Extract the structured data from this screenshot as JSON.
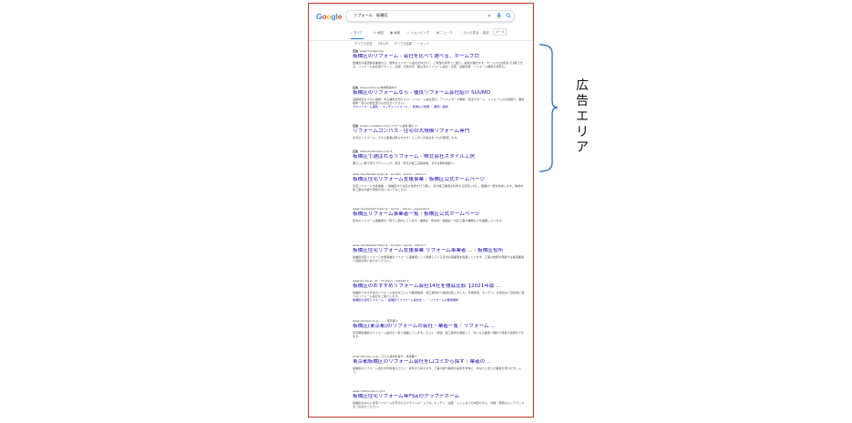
{
  "google": {
    "logo_letters": [
      {
        "ch": "G",
        "color": "#4285f4"
      },
      {
        "ch": "o",
        "color": "#ea4335"
      },
      {
        "ch": "o",
        "color": "#fbbc05"
      },
      {
        "ch": "g",
        "color": "#4285f4"
      },
      {
        "ch": "l",
        "color": "#34a853"
      },
      {
        "ch": "e",
        "color": "#ea4335"
      }
    ],
    "search_query": "リフォーム　板橋区",
    "tabs": [
      {
        "label": "すべて",
        "active": true
      },
      {
        "label": "地図",
        "active": false
      },
      {
        "label": "画像",
        "active": false
      },
      {
        "label": "ショッピング",
        "active": false
      },
      {
        "label": "ニュース",
        "active": false
      },
      {
        "label": "もっと見る",
        "active": false
      }
    ],
    "settings_label": "設定",
    "tools_label": "ツール",
    "filters": [
      "すべての言語",
      "1年以内",
      "すべての結果",
      "リセット"
    ]
  },
  "results": [
    {
      "ad": true,
      "ad_label": "広告",
      "url": "www.homepro.jp/",
      "title": "板橋区のリフォーム - 会社を比べて選べる、ホームプロ",
      "snippet": "板橋区の厳選優良業者から、優秀なリフォーム会社を5社まで、ご希望の条件でご紹介、提案が届きます。ホームプロは匿名で比較できる、リフォーム会社紹介サイト。全国・大阪方式・独立系のリフォーム会社・比較・実績多数・リフォーム費用の目安も。",
      "links": ""
    },
    {
      "ad": true,
      "ad_label": "広告",
      "url": "www.suumo.jp/地域別案内 ▾",
      "title": "板橋区のリフォームなら - 優良リフォーム会社紹介 SUUMO",
      "snippet": "実績豊富なプロに相談！安心費用を知りたい！リフォーム会社選び、アドバイザーが無料・完全サポート。リフォームのお見積り、費用相場・安心の会社選びはお任せください。",
      "links": "ブルリフォーム事例 ・ キッチンリフォーム ・ 見積もり依頼 ・ 費用・相場"
    },
    {
      "ad": true,
      "ad_label": "広告",
      "url": "www.r-compass.com/リフォーム会社/紹介 ▾",
      "title": "リフォームコンパス - 住宅の大規模リフォーム専門",
      "snippet": "大切なリフォーム、できる業者は限られます！ピッタリの会社をプロが厳選します。",
      "links": ""
    },
    {
      "ad": true,
      "ad_label": "広告",
      "url": "www.stylehouse.com/ ▾",
      "title": "板橋区で選ばれるリフォーム - 株式会社スタイル工房",
      "snippet": "暮らしに寄り添うプランニング。東京・埼玉の施工実績多数。まずは無料相談へ。",
      "links": ""
    },
    {
      "ad": false,
      "ad_label": "",
      "url": "www.city.itabashi.tokyo.jp › kurashi › sumai › reform ▾",
      "title": "板橋区住宅リフォーム支援事業｜板橋区公式ホームページ",
      "snippet": "住宅リフォーム支援事業 … 板橋区内で住宅の改修を行う際に、区内施工業者を利用する区民に対し、経費の一部を助成します。助成対象工事の内容や申請方法についてはこちら。",
      "links": ""
    },
    {
      "ad": false,
      "ad_label": "",
      "url": "www.city.itabashi.tokyo.jp › sumai › reform › jigyousha ▾",
      "title": "板橋区リフォーム事業者一覧｜板橋区公式ホームページ",
      "snippet": "区内のリフォーム事業者を一覧でご案内しています。業者名・所在地・連絡先・対応工事の種類などを掲載しています。",
      "links": ""
    },
    {
      "ad": false,
      "ad_label": "",
      "url": "www.city.itabashi.tokyo.jp › kurashi › sumai › reform ▾",
      "title": "板橋区住宅リフォーム支援事業 リフォーム事業者 ... - 板橋区役所",
      "snippet": "板橋区住宅リフォーム支援事業のリフォーム事業者として登録している区内の事業者を掲載しています。工事の依頼や見積りは各事業者へ直接お問い合わせください。",
      "links": ""
    },
    {
      "ad": false,
      "ad_label": "",
      "url": "www.rtc-hai.jp › itr › 73 tokyo › itabashi ▾",
      "title": "板橋区のおすすめリフォーム会社14社を徹底比較【2021年版 ...",
      "snippet": "板橋区でおすすめのリフォーム会社を口コミや費用相場、施工事例から徹底比較しました。外壁塗装、キッチン、お風呂など目的別に選べるリフォーム会社をご紹介します。",
      "links": "板橋区の住宅リフォーム ・ 板橋区でリフォーム会社を … ・ リフォームの費用相場"
    },
    {
      "ad": false,
      "ad_label": "",
      "url": "www.refospot.co.jp › … › 東京都 ▾",
      "title": "板橋区(東京都)のリフォームの会社・業者一覧｜リフォーム ...",
      "snippet": "東京都板橋区のリフォーム会社を一覧で掲載しています。口コミ・評価・施工事例を確認して、気になる業者へ無料で見積り依頼ができます。",
      "links": ""
    },
    {
      "ad": false,
      "ad_label": "",
      "url": "www.refonavi.co.jp › 口コミ評判を探す › 東京都 ▾",
      "title": "東京都板橋区のリフォーム会社を口コミから探す｜業者の ...",
      "snippet": "板橋区のリフォーム会社を利用者の口コミ・評判から探せます。工事内容や費用の実例を参考に、あなたに合った業者を見つけましょう。",
      "links": ""
    },
    {
      "ad": false,
      "ad_label": "",
      "url": "www.craft-home.co.jp ▾",
      "title": "板橋区住宅リフォーム専門店のクラフトホーム",
      "snippet": "板橋区を中心に住宅リフォームを手がけるクラフトホームです。キッチン・浴室・トイレなどの水回りから、外壁・屋根のメンテナンスまでお任せください。",
      "links": ""
    }
  ],
  "annotation": {
    "label_chars": [
      "広",
      "告",
      "エ",
      "リ",
      "ア"
    ],
    "bracket_color": "#1f5fae"
  }
}
